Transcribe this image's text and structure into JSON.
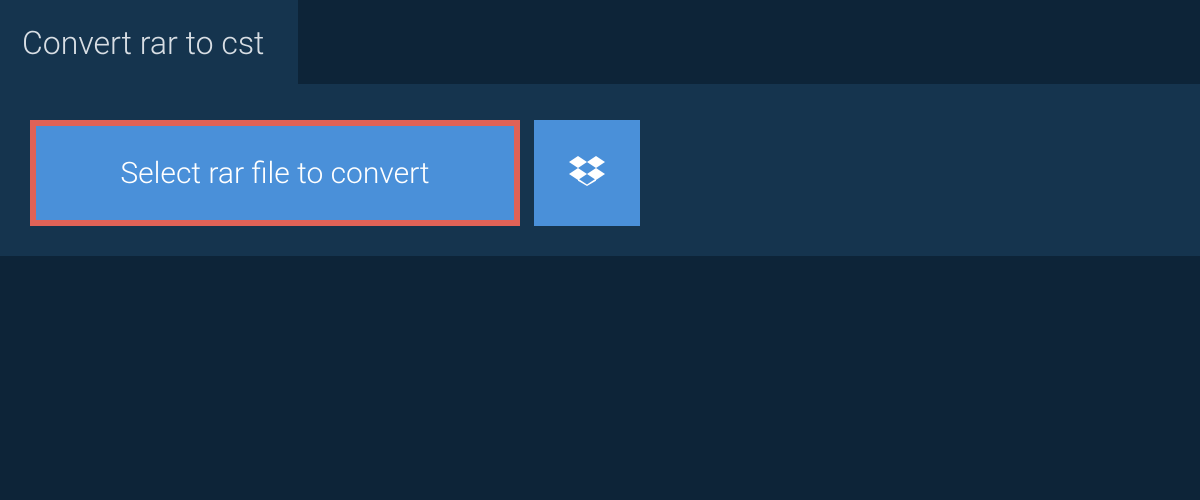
{
  "header": {
    "title": "Convert rar to cst"
  },
  "actions": {
    "select_file_label": "Select rar file to convert"
  }
}
